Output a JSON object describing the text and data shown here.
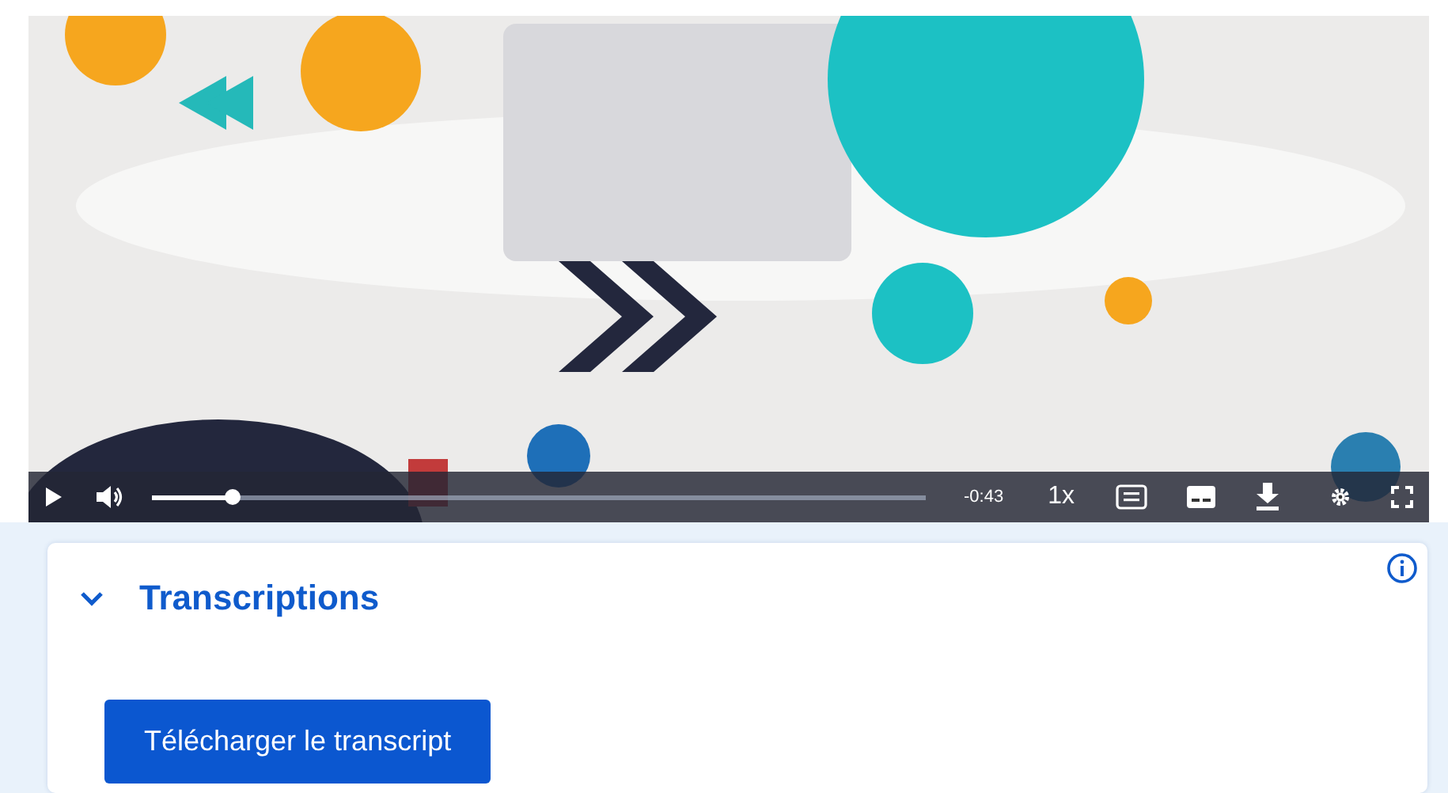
{
  "player": {
    "kind": "picture",
    "playing": false,
    "progress": {
      "level": 0.105
    },
    "time_remaining": "-0:43",
    "speed": "1x"
  },
  "transcriptions": {
    "title": "Transcriptions",
    "expanded": true,
    "button": "Télécharger le transcript"
  }
}
